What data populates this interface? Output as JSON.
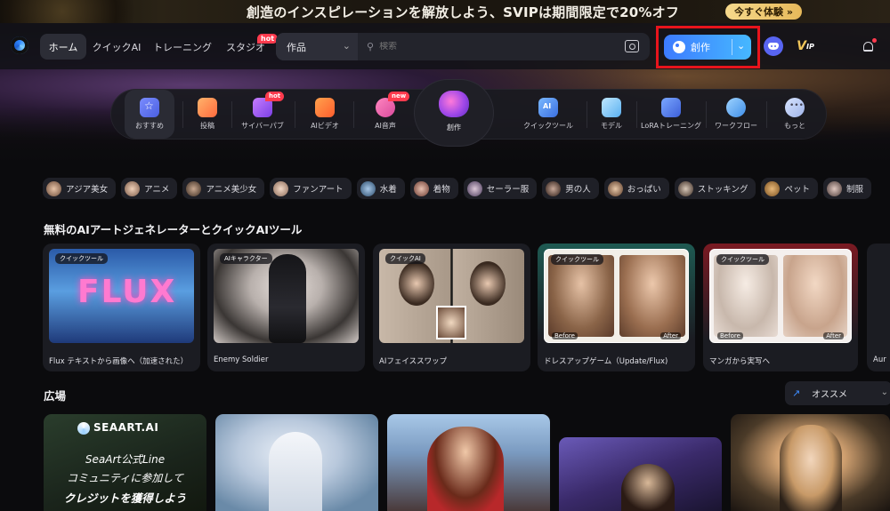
{
  "banner": {
    "text": "創造のインスピレーションを解放しよう、SVIPは期間限定で20%オフ",
    "cta": "今すぐ体験 »"
  },
  "nav": {
    "tabs": [
      {
        "label": "ホーム",
        "active": true
      },
      {
        "label": "クイックAI",
        "active": false
      },
      {
        "label": "トレーニング",
        "active": false
      },
      {
        "label": "スタジオ",
        "active": false,
        "badge": "hot"
      }
    ],
    "search": {
      "category": "作品",
      "placeholder": "検索"
    },
    "create_button": "創作",
    "icons": [
      "discord-icon",
      "vip-icon",
      "apps-grid-icon",
      "bell-icon"
    ],
    "vip_label": "V",
    "vip_sub": "IP",
    "highlight_color": "#e8141c"
  },
  "toolbar": {
    "items": [
      {
        "label": "おすすめ",
        "icon": "star-icon",
        "active": true
      },
      {
        "label": "投稿",
        "icon": "post-icon"
      },
      {
        "label": "サイバーパブ",
        "icon": "cyberpub-icon",
        "badge": "hot"
      },
      {
        "label": "AIビデオ",
        "icon": "video-icon"
      },
      {
        "label": "AI音声",
        "icon": "voice-icon",
        "badge": "new"
      },
      {
        "label": "クイックツール",
        "icon": "ai-tool-icon"
      },
      {
        "label": "モデル",
        "icon": "cube-icon"
      },
      {
        "label": "LoRAトレーニング",
        "icon": "lora-icon"
      },
      {
        "label": "ワークフロー",
        "icon": "workflow-icon"
      },
      {
        "label": "もっと",
        "icon": "more-icon"
      }
    ],
    "center_label": "創作"
  },
  "tags": [
    "アジア美女",
    "アニメ",
    "アニメ美少女",
    "ファンアート",
    "水着",
    "着物",
    "セーラー服",
    "男の人",
    "おっぱい",
    "ストッキング",
    "ペット",
    "制服"
  ],
  "tools_section": {
    "title": "無料のAIアートジェネレーターとクイックAIツール",
    "cards": [
      {
        "badge": "クイックツール",
        "title": "Flux テキストから画像へ（加速された）",
        "thumb_text": "FLUX"
      },
      {
        "badge": "AIキャラクター",
        "title": "Enemy Soldier"
      },
      {
        "badge": "クイックAI",
        "title": "AIフェイススワップ"
      },
      {
        "badge": "クイックツール",
        "title": "ドレスアップゲーム（Update/Flux)",
        "before": "Before",
        "after": "After"
      },
      {
        "badge": "クイックツール",
        "title": "マンガから実写へ",
        "before": "Before",
        "after": "After"
      },
      {
        "badge": "",
        "title": "Aur"
      }
    ]
  },
  "gallery_section": {
    "title": "広場",
    "sort_label": "オススメ",
    "promo": {
      "brand": "SEAART.AI",
      "line1": "SeaArt公式Line",
      "line2": "コミュニティに参加して",
      "line3": "クレジットを獲得しよう"
    }
  },
  "colors": {
    "accent_blue": "#3d7bff",
    "hot_red": "#ff3b4e",
    "gold": "#f1c65a"
  }
}
